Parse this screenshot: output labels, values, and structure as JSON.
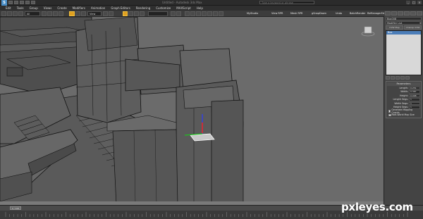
{
  "app": {
    "title": "Untitled - Autodesk 3ds Max",
    "search_placeholder": "Type a keyword or phrase",
    "window_controls": [
      "_",
      "□",
      "×"
    ],
    "logo_icon": "max-logo-icon"
  },
  "menu": [
    "Edit",
    "Tools",
    "Group",
    "Views",
    "Create",
    "Modifiers",
    "Animation",
    "Graph Editors",
    "Rendering",
    "Customize",
    "MAXScript",
    "Help"
  ],
  "toolbar": {
    "selection_filter": "All",
    "reference_coord": "View",
    "named_selection": "",
    "right_items": [
      "MyStudio",
      "View RPR",
      "Mesh RPR",
      "gSnapDown",
      "Undo",
      "BatchRender",
      "ReManagerEditor",
      "RenderNode"
    ]
  },
  "command_panel": {
    "object_name": "Box008",
    "modifier_list": "Modifier List",
    "stack_buttons": [
      "UVW Map",
      "Unwrap UVW"
    ],
    "stack_items": [
      "Box"
    ],
    "rollout_title": "Parameters",
    "params": [
      {
        "label": "Length:",
        "value": "0.251"
      },
      {
        "label": "Width:",
        "value": "0.387"
      },
      {
        "label": "Height:",
        "value": "0.008"
      },
      {
        "label": "Length Segs:",
        "value": "1"
      },
      {
        "label": "Width Segs:",
        "value": "1"
      },
      {
        "label": "Height Segs:",
        "value": "1"
      }
    ],
    "checkboxes": [
      "Generate Mapping Coords.",
      "Real-World Map Size"
    ]
  },
  "timeline": {
    "slider_label": "0 / 100"
  },
  "watermark": "pxleyes.com"
}
